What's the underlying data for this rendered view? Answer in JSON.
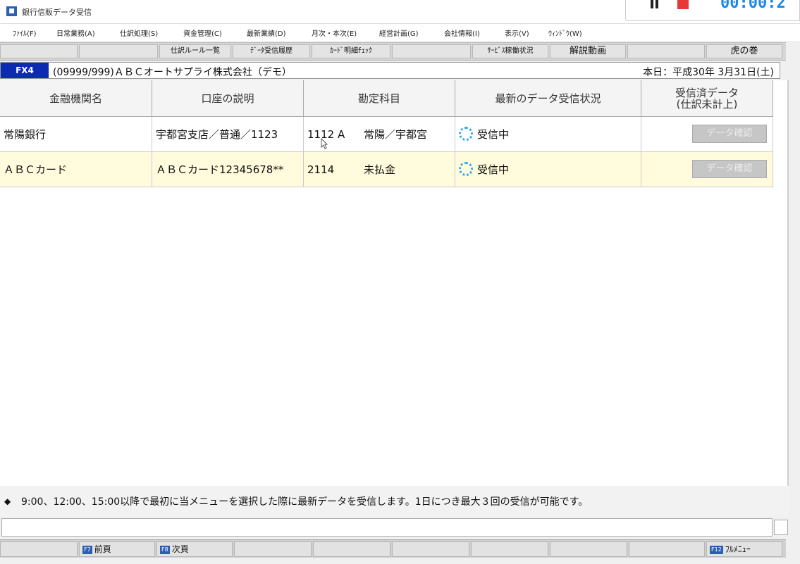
{
  "window": {
    "title": "銀行信販データ受信",
    "icon": "app-icon"
  },
  "recorder": {
    "timer": "00:00:2"
  },
  "menu": [
    "ﾌｧｲﾙ(F)",
    "日常業務(A)",
    "仕訳処理(S)",
    "資金管理(C)",
    "最新業績(D)",
    "月次・本次(E)",
    "経営計画(G)",
    "会社情報(I)",
    "表示(V)",
    "ｳｨﾝﾄﾞｳ(W)"
  ],
  "toolbar": {
    "journal_rules": "仕訳ルール一覧",
    "receive_history": "ﾃﾞｰﾀ受信履歴",
    "card_check": "ｶｰﾄﾞ明細ﾁｪｯｸ",
    "service_status": "ｻｰﾋﾞｽ稼働状況",
    "video": "解説動画",
    "tora": "虎の巻"
  },
  "company": {
    "code": "FX4",
    "name": "(09999/999)ＡＢＣオートサプライ株式会社（デモ）",
    "date": "本日：平成30年 3月31日(土)"
  },
  "table": {
    "headers": {
      "institution": "金融機関名",
      "description": "口座の説明",
      "account": "勘定科目",
      "status": "最新のデータ受信状況",
      "received": "受信済データ\n(仕訳未計上)"
    },
    "rows": [
      {
        "institution": "常陽銀行",
        "description": "宇都宮支店／普通／1123",
        "account_code": "1112 A",
        "account_name": "常陽／宇都宮",
        "status": "受信中",
        "button": "データ確認"
      },
      {
        "institution": "ＡＢＣカード",
        "description": "ＡＢＣカード12345678**",
        "account_code": "2114",
        "account_name": "未払金",
        "status": "受信中",
        "button": "データ確認"
      }
    ]
  },
  "note": {
    "symbol": "◆",
    "text": "9:00、12:00、15:00以降で最初に当メニューを選択した際に最新データを受信します。1日につき最大３回の受信が可能です。"
  },
  "fkeys": {
    "f7_badge": "F7",
    "f7_label": "前頁",
    "f8_badge": "F8",
    "f8_label": "次頁",
    "f12_badge": "F12",
    "f12_label": "ﾌﾙﾒﾆｭｰ"
  }
}
